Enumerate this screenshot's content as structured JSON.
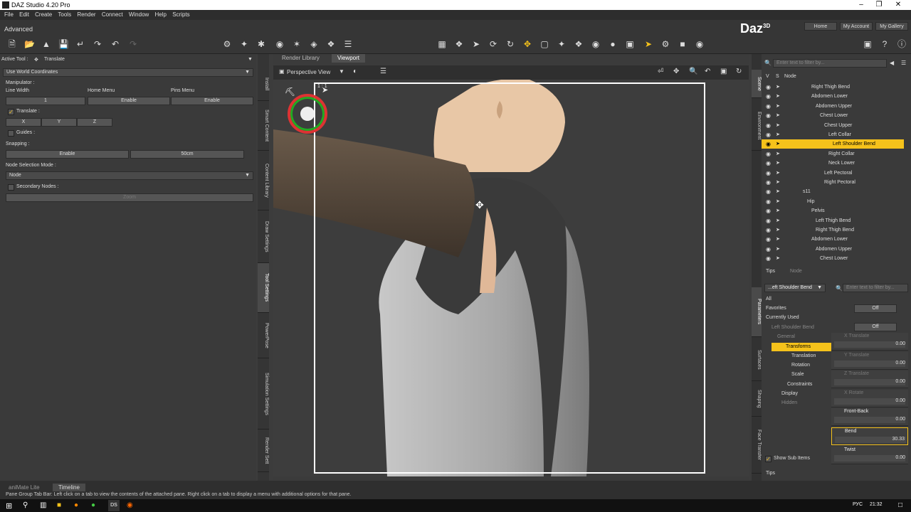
{
  "window": {
    "title": "DAZ Studio 4.20 Pro"
  },
  "menu": [
    "File",
    "Edit",
    "Create",
    "Tools",
    "Render",
    "Connect",
    "Window",
    "Help",
    "Scripts"
  ],
  "mode": "Advanced",
  "header_buttons": {
    "home": "Home",
    "account": "My Account",
    "gallery": "My Gallery"
  },
  "brand": "Daz",
  "brand_sup": "3D",
  "left": {
    "active_tool_label": "Active Tool :",
    "active_tool": "Translate",
    "coord": "Use World Coordinates",
    "manipulator": "Manipulator :",
    "line_width": "Line Width",
    "home_menu": "Home Menu",
    "pins_menu": "Pins Menu",
    "line_width_val": "1",
    "home_val": "Enable",
    "pins_val": "Enable",
    "translate": "Translate :",
    "x": "X",
    "y": "Y",
    "z": "Z",
    "guides": "Guides :",
    "snapping": "Snapping :",
    "snap_enable": "Enable",
    "snap_val": "50cm",
    "node_sel": "Node Selection Mode :",
    "node_val": "Node",
    "secondary": "Secondary Nodes :",
    "zoom_btn": "Zoom"
  },
  "left_vtabs": [
    "Install",
    "Smart Content",
    "Content Library",
    "Draw Settings",
    "Tool Settings",
    "PowerPose",
    "Simulation Settings",
    "Render Sett"
  ],
  "view": {
    "tabs": [
      "Render Library",
      "Viewport"
    ],
    "camera": "Perspective View",
    "ratio": "1 : 1"
  },
  "scene": {
    "search_placeholder": "Enter text to filter by...",
    "col_v": "V",
    "col_s": "S",
    "col_node": "Node",
    "items": [
      {
        "label": "Right Thigh Bend",
        "indent": 0
      },
      {
        "label": "Abdomen Lower",
        "indent": 0
      },
      {
        "label": "Abdomen Upper",
        "indent": 1
      },
      {
        "label": "Chest Lower",
        "indent": 2
      },
      {
        "label": "Chest Upper",
        "indent": 3
      },
      {
        "label": "Left Collar",
        "indent": 4
      },
      {
        "label": "Left Shoulder Bend",
        "indent": 5,
        "selected": true
      },
      {
        "label": "Right Collar",
        "indent": 4
      },
      {
        "label": "Neck Lower",
        "indent": 4
      },
      {
        "label": "Left Pectoral",
        "indent": 3
      },
      {
        "label": "Right Pectoral",
        "indent": 3
      },
      {
        "label": "s11",
        "indent": -2
      },
      {
        "label": "Hip",
        "indent": -1
      },
      {
        "label": "Pelvis",
        "indent": 0
      },
      {
        "label": "Left Thigh Bend",
        "indent": 1
      },
      {
        "label": "Right Thigh Bend",
        "indent": 1
      },
      {
        "label": "Abdomen Lower",
        "indent": 0
      },
      {
        "label": "Abdomen Upper",
        "indent": 1
      },
      {
        "label": "Chest Lower",
        "indent": 2
      }
    ],
    "tabs": [
      "Tips",
      "Node"
    ]
  },
  "right_vtabs": [
    "Scene",
    "Environment",
    "Parameters",
    "Surfaces",
    "Shaping",
    "Face Transfer"
  ],
  "params": {
    "node_select": "...eft Shoulder Bend",
    "filter_placeholder": "Enter text to filter by...",
    "tree": [
      "All",
      "Favorites",
      "Currently Used",
      "Left Shoulder Bend",
      "General",
      "Transforms",
      "Translation",
      "Rotation",
      "Scale",
      "Constraints",
      "Display",
      "Hidden"
    ],
    "off1": "Off",
    "off2": "Off",
    "sliders": [
      {
        "label": "X Translate",
        "val": "0.00"
      },
      {
        "label": "Y Translate",
        "val": "0.00"
      },
      {
        "label": "Z Translate",
        "val": "0.00"
      },
      {
        "label": "X Rotate",
        "val": "0.00"
      },
      {
        "label": "Front-Back",
        "val": "0.00"
      },
      {
        "label": "Bend",
        "val": "30.33"
      },
      {
        "label": "Twist",
        "val": "0.00"
      }
    ],
    "show_sub": "Show Sub Items",
    "tips": "Tips"
  },
  "bottom": {
    "tabs": [
      "aniMate Lite",
      "Timeline"
    ],
    "status": "Pane Group Tab Bar: Left click on a tab to view the contents of the attached pane. Right click on a tab to display a menu with additional options for that pane."
  },
  "taskbar": {
    "lang": "РУС",
    "time": "21:32"
  }
}
